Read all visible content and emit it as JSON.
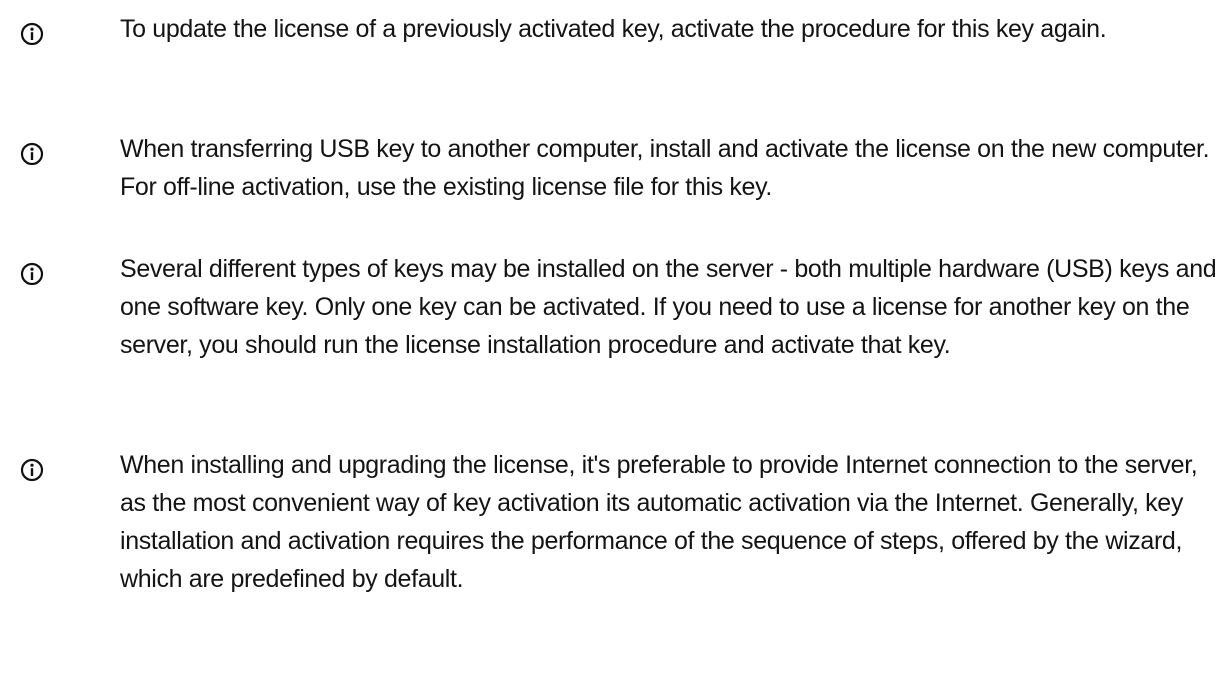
{
  "notes": [
    {
      "icon": "info-icon",
      "text": "To update the license of a previously activated key, activate the procedure for this key again."
    },
    {
      "icon": "info-icon",
      "text": "When transferring USB key to another computer, install and activate the license on the new computer. For off-line activation, use the existing license file for this key."
    },
    {
      "icon": "info-icon",
      "text": "Several different types of keys may be installed on the server - both multiple hardware (USB) keys and one software key. Only one key can be activated. If you need to use a license for another key on the server, you should run the license installation procedure and activate that key."
    },
    {
      "icon": "info-icon",
      "text": "When installing and upgrading the license, it's preferable to provide Internet connection to the server, as the most convenient way of key activation its automatic activation via the Internet. Generally, key installation and activation requires the performance of the sequence of steps, offered by the wizard, which are predefined by default."
    }
  ]
}
